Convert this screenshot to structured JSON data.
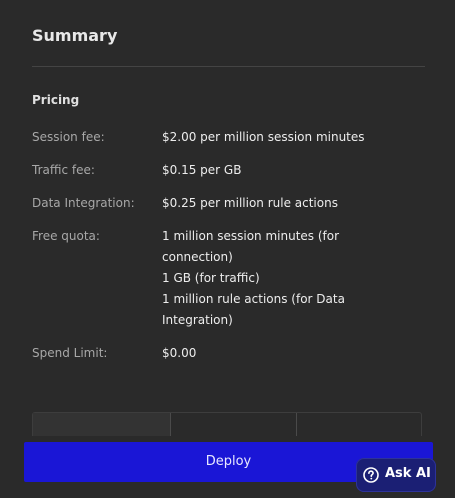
{
  "summary": {
    "title": "Summary"
  },
  "pricing": {
    "section_title": "Pricing",
    "rows": [
      {
        "label": "Session fee:",
        "value_lines": [
          "$2.00 per million session minutes"
        ]
      },
      {
        "label": "Traffic fee:",
        "value_lines": [
          "$0.15 per GB"
        ]
      },
      {
        "label": "Data Integration:",
        "value_lines": [
          "$0.25 per million rule actions"
        ]
      },
      {
        "label": "Free quota:",
        "value_lines": [
          "1 million session minutes (for connection)",
          "1 GB (for traffic)",
          "1 million rule actions (for Data Integration)"
        ]
      },
      {
        "label": "Spend Limit:",
        "value_lines": [
          "$0.00"
        ]
      }
    ]
  },
  "actions": {
    "deploy_label": "Deploy",
    "ask_ai_label": "Ask AI"
  },
  "colors": {
    "background": "#2a2a2a",
    "deploy_button": "#1a16d6",
    "ask_ai_button": "#1b1f74"
  },
  "icons": {
    "ask_ai": "question-circle-icon"
  }
}
